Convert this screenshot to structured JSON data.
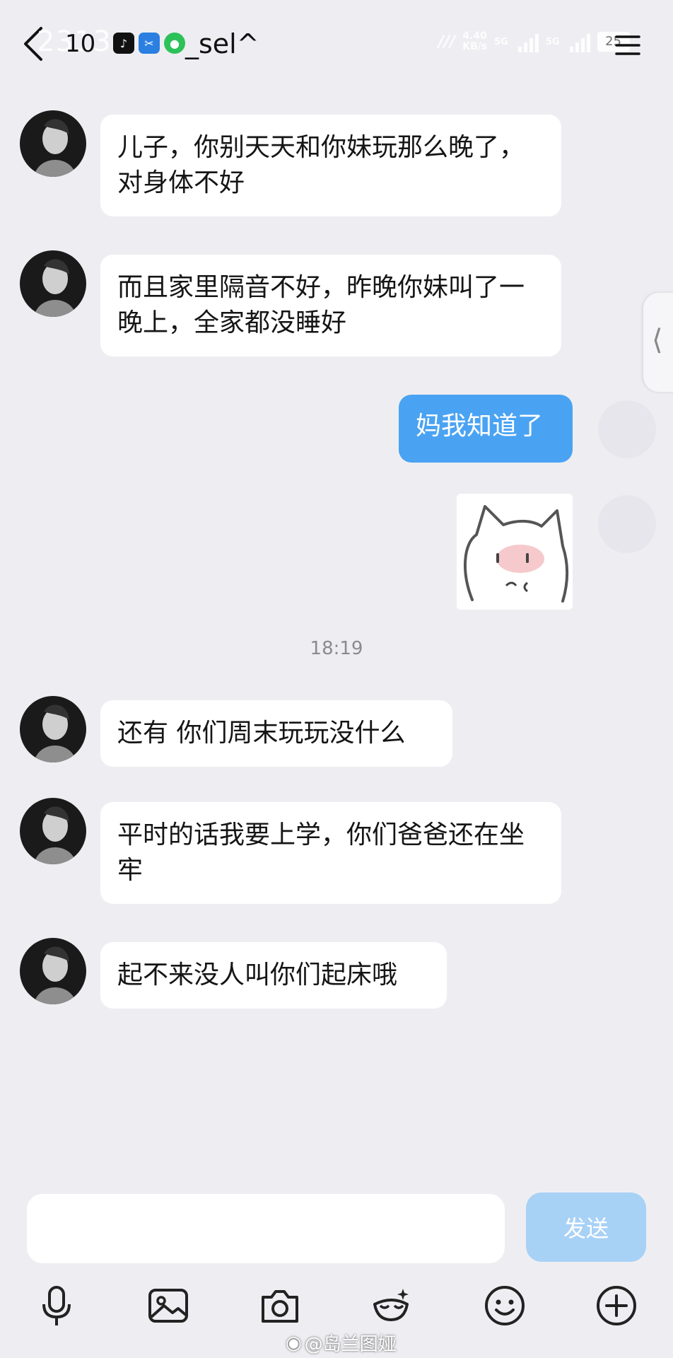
{
  "header": {
    "title_overlay": "2313",
    "count": "10",
    "name": "_sel^",
    "net_speed": "4.40",
    "net_unit": "KB/s",
    "sim1": "5G",
    "sim2": "5G",
    "battery": "25"
  },
  "messages": [
    {
      "direction": "incoming",
      "text": "儿子，你别天天和你妹玩那么晚了，对身体不好"
    },
    {
      "direction": "incoming",
      "text": "而且家里隔音不好，昨晚你妹叫了一晚上，全家都没睡好"
    },
    {
      "direction": "outgoing",
      "text": "妈我知道了"
    },
    {
      "direction": "outgoing",
      "type": "sticker"
    },
    {
      "timestamp": "18:19"
    },
    {
      "direction": "incoming",
      "text": "还有 你们周末玩玩没什么"
    },
    {
      "direction": "incoming",
      "text": "平时的话我要上学，你们爸爸还在坐牢"
    },
    {
      "direction": "incoming",
      "text": "起不来没人叫你们起床哦"
    }
  ],
  "composer": {
    "input_value": "",
    "send_label": "发送"
  },
  "toolbar": [
    "mic-icon",
    "image-icon",
    "camera-icon",
    "emoji-icon",
    "smiley-icon",
    "plus-icon"
  ],
  "watermark": {
    "text": "@岛兰图娅"
  },
  "colors": {
    "background": "#eeeef2",
    "outgoing_bubble": "#4aa3f2",
    "send_button": "#a8d1f6"
  }
}
